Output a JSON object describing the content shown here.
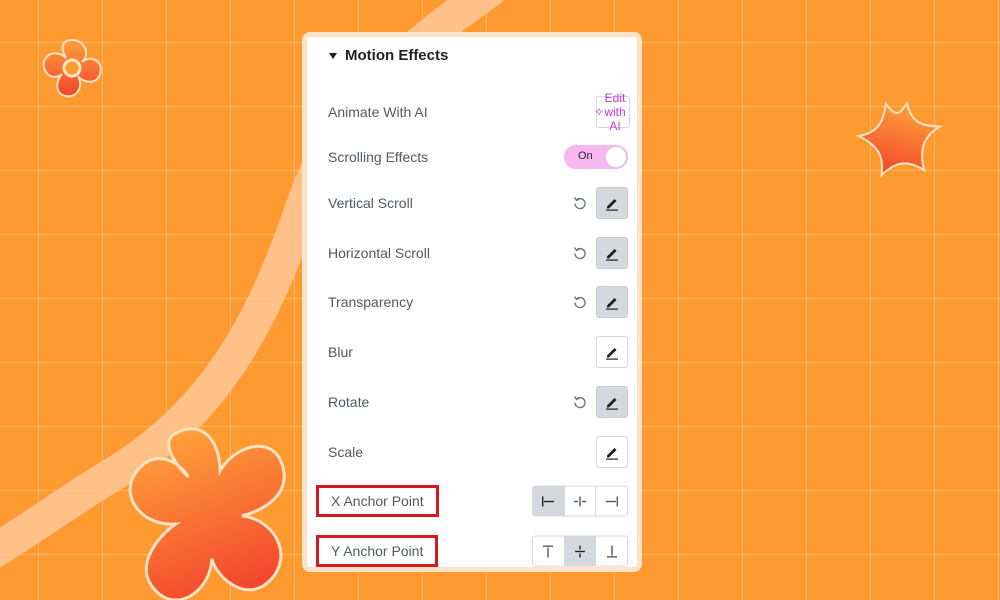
{
  "colors": {
    "background": "#ff9a30",
    "accent_pink": "#f6b6f0",
    "ai_purple": "#c23bd8",
    "highlight_red": "#d7191f"
  },
  "panel": {
    "title": "Motion Effects",
    "header_icon": "caret-down-icon",
    "animate_ai": {
      "label": "Animate With AI",
      "button_text": "Edit with AI",
      "icon": "sparkle-icon"
    },
    "scrolling": {
      "label": "Scrolling Effects",
      "toggle_text": "On",
      "state": "on"
    },
    "effects": [
      {
        "label": "Vertical Scroll",
        "reset": true,
        "active": true
      },
      {
        "label": "Horizontal Scroll",
        "reset": true,
        "active": true
      },
      {
        "label": "Transparency",
        "reset": true,
        "active": true
      },
      {
        "label": "Blur",
        "reset": false,
        "active": false
      },
      {
        "label": "Rotate",
        "reset": true,
        "active": true
      },
      {
        "label": "Scale",
        "reset": false,
        "active": false
      }
    ],
    "x_anchor": {
      "label": "X Anchor Point",
      "options": [
        "align-left-icon",
        "align-center-icon",
        "align-right-icon"
      ],
      "selected": "align-left-icon"
    },
    "y_anchor": {
      "label": "Y Anchor Point",
      "options": [
        "align-top-icon",
        "align-middle-icon",
        "align-bottom-icon"
      ],
      "selected": "align-middle-icon"
    }
  }
}
